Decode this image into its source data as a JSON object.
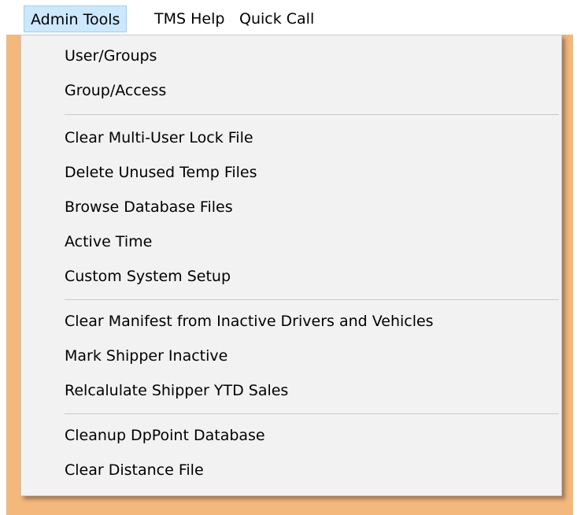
{
  "menubar": {
    "items": [
      {
        "label": "Admin Tools",
        "active": true
      },
      {
        "label": "TMS Help",
        "active": false
      },
      {
        "label": "Quick Call",
        "active": false
      }
    ]
  },
  "dropdown": {
    "items": [
      {
        "label": "User/Groups"
      },
      {
        "label": "Group/Access"
      },
      {
        "label": "Clear Multi-User Lock File"
      },
      {
        "label": "Delete Unused Temp Files"
      },
      {
        "label": "Browse Database Files"
      },
      {
        "label": "Active Time"
      },
      {
        "label": "Custom System Setup"
      },
      {
        "label": "Clear Manifest from Inactive Drivers and Vehicles"
      },
      {
        "label": "Mark Shipper Inactive"
      },
      {
        "label": "Relcalulate Shipper YTD Sales"
      },
      {
        "label": "Cleanup DpPoint Database"
      },
      {
        "label": "Clear Distance File"
      }
    ]
  },
  "colors": {
    "app_background": "#f4b77c",
    "menu_background": "#f2f2f2",
    "active_menubar_fill": "#cce8ff",
    "active_menubar_border": "#99d1ff"
  }
}
